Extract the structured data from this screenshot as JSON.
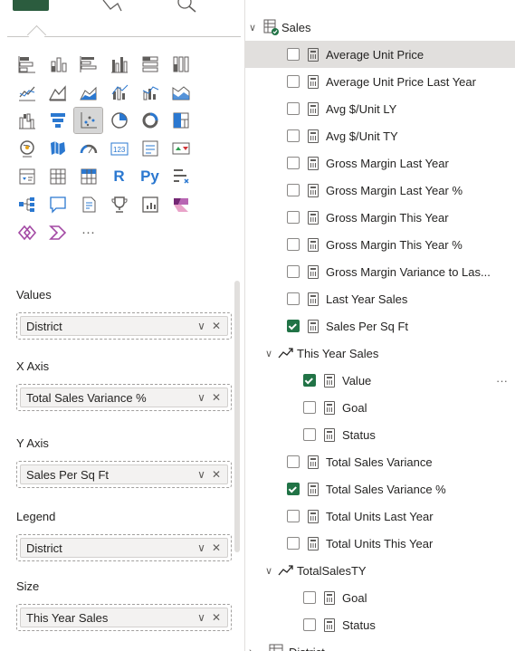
{
  "visual_gallery": {
    "icons": [
      [
        "stacked-bar-icon",
        "stacked-column-icon",
        "clustered-bar-icon",
        "clustered-column-icon",
        "100-percent-bar-icon",
        "100-percent-column-icon"
      ],
      [
        "line-chart-icon",
        "area-chart-icon",
        "stacked-area-icon",
        "line-column-icon",
        "line-clustered-column-icon",
        "ribbon-chart-icon"
      ],
      [
        "waterfall-icon",
        "funnel-icon",
        "scatter-chart-icon",
        "pie-chart-icon",
        "donut-chart-icon",
        "treemap-icon"
      ],
      [
        "map-icon",
        "filled-map-icon",
        "gauge-icon",
        "card-icon",
        "multi-row-card-icon",
        "kpi-icon"
      ],
      [
        "slicer-icon",
        "table-icon",
        "matrix-icon",
        "r-visual-icon",
        "python-visual-icon",
        "key-influencers-icon"
      ],
      [
        "decomposition-tree-icon",
        "qna-icon",
        "smart-narrative-icon",
        "goals-icon",
        "paginated-report-icon",
        "power-apps-icon"
      ],
      [
        "power-automate-icon",
        "azure-map-icon",
        "more-visuals-icon"
      ]
    ],
    "text_icons": {
      "r": "R",
      "py": "Py",
      "more": "···"
    }
  },
  "wells": [
    {
      "label": "Values",
      "field": "District"
    },
    {
      "label": "X Axis",
      "field": "Total Sales Variance %"
    },
    {
      "label": "Y Axis",
      "field": "Sales Per Sq Ft"
    },
    {
      "label": "Legend",
      "field": "District"
    },
    {
      "label": "Size",
      "field": "This Year Sales"
    }
  ],
  "pill_icons": {
    "expand": "∨",
    "remove": "✕"
  },
  "fields": {
    "table_name": "Sales",
    "items": [
      {
        "name": "Average Unit Price",
        "checked": false
      },
      {
        "name": "Average Unit Price Last Year",
        "checked": false
      },
      {
        "name": "Avg $/Unit LY",
        "checked": false
      },
      {
        "name": "Avg $/Unit TY",
        "checked": false
      },
      {
        "name": "Gross Margin Last Year",
        "checked": false
      },
      {
        "name": "Gross Margin Last Year %",
        "checked": false
      },
      {
        "name": "Gross Margin This Year",
        "checked": false
      },
      {
        "name": "Gross Margin This Year %",
        "checked": false
      },
      {
        "name": "Gross Margin Variance to Las...",
        "checked": false
      },
      {
        "name": "Last Year Sales",
        "checked": false
      },
      {
        "name": "Sales Per Sq Ft",
        "checked": true
      }
    ],
    "kpi1": {
      "name": "This Year Sales",
      "children": [
        {
          "name": "Value",
          "checked": true
        },
        {
          "name": "Goal",
          "checked": false
        },
        {
          "name": "Status",
          "checked": false
        }
      ]
    },
    "items2": [
      {
        "name": "Total Sales Variance",
        "checked": false
      },
      {
        "name": "Total Sales Variance %",
        "checked": true
      },
      {
        "name": "Total Units Last Year",
        "checked": false
      },
      {
        "name": "Total Units This Year",
        "checked": false
      }
    ],
    "kpi2": {
      "name": "TotalSalesTY",
      "children": [
        {
          "name": "Goal",
          "checked": false
        },
        {
          "name": "Status",
          "checked": false
        }
      ]
    },
    "next_table": "District",
    "more_options": "···",
    "chevron": "∨"
  },
  "colors": {
    "accent_green": "#217346",
    "highlight": "#e1dfdd"
  }
}
